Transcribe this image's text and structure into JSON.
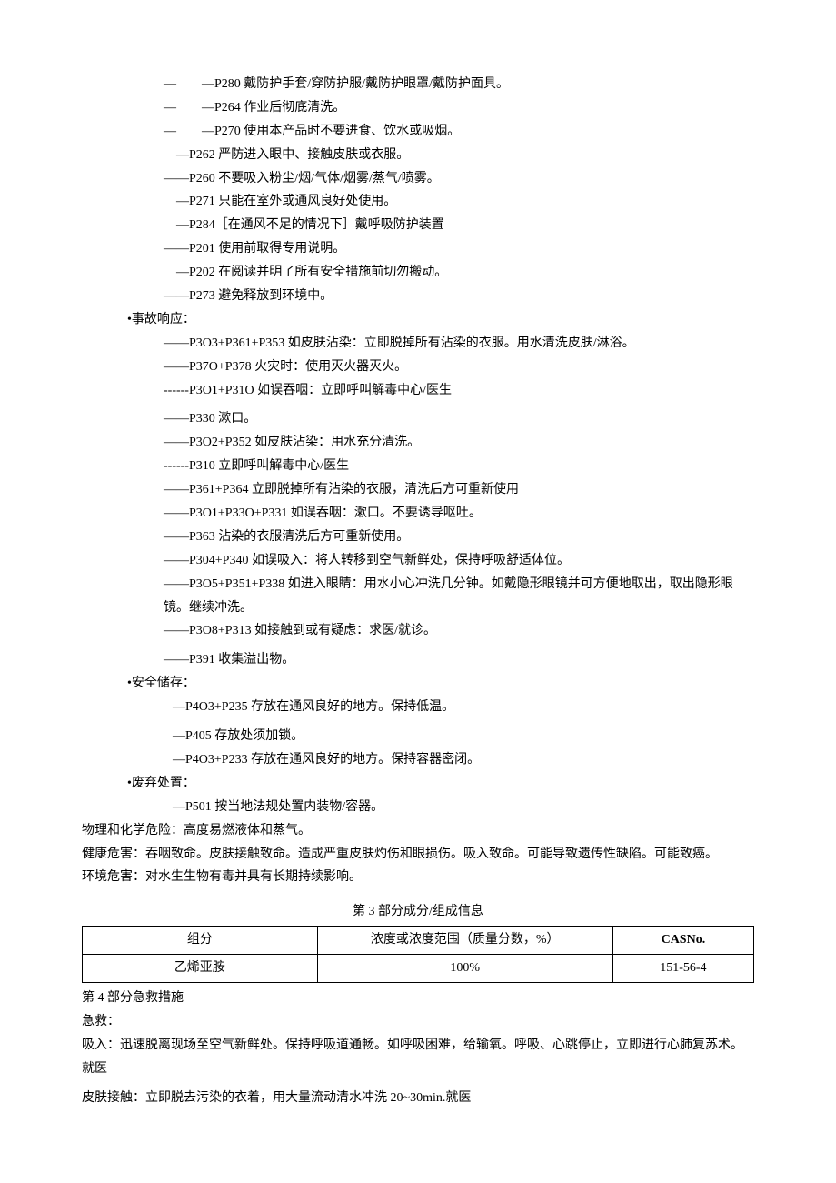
{
  "prevention": [
    "—　　—P280 戴防护手套/穿防护服/戴防护眼罩/戴防护面具。",
    "—　　—P264 作业后彻底清洗。",
    "—　　—P270 使用本产品时不要进食、饮水或吸烟。",
    "　—P262 严防进入眼中、接触皮肤或衣服。",
    "——P260 不要吸入粉尘/烟/气体/烟雾/蒸气/喷雾。",
    "　—P271 只能在室外或通风良好处使用。",
    "　—P284［在通风不足的情况下］戴呼吸防护装置",
    "——P201 使用前取得专用说明。",
    "　—P202 在阅读并明了所有安全措施前切勿搬动。",
    "——P273 避免释放到环境中。"
  ],
  "accident_label": "•事故响应：",
  "accident": [
    "——P3O3+P361+P353 如皮肤沾染：立即脱掉所有沾染的衣服。用水清洗皮肤/淋浴。",
    "——P37O+P378 火灾时：使用灭火器灭火。",
    "------P3O1+P31O 如误吞咽：立即呼叫解毒中心/医生",
    "——P330 漱口。",
    "——P3O2+P352 如皮肤沾染：用水充分清洗。",
    "------P310 立即呼叫解毒中心/医生",
    "——P361+P364 立即脱掉所有沾染的衣服，清洗后方可重新使用",
    "——P3O1+P33O+P331 如误吞咽：漱口。不要诱导呕吐。",
    "——P363 沾染的衣服清洗后方可重新使用。",
    "——P304+P340 如误吸入：将人转移到空气新鲜处，保持呼吸舒适体位。",
    "——P3O5+P351+P338 如进入眼睛：用水小心冲洗几分钟。如戴隐形眼镜并可方便地取出，取出隐形眼镜。继续冲洗。",
    "——P3O8+P313 如接触到或有疑虑：求医/就诊。",
    "——P391 收集溢出物。"
  ],
  "storage_label": "•安全储存：",
  "storage": [
    "—P4O3+P235 存放在通风良好的地方。保持低温。",
    "—P405 存放处须加锁。",
    "—P4O3+P233 存放在通风良好的地方。保持容器密闭。"
  ],
  "disposal_label": "•废弃处置：",
  "disposal": [
    "—P501 按当地法规处置内装物/容器。"
  ],
  "hazards": {
    "physical": "物理和化学危险：高度易燃液体和蒸气。",
    "health": "健康危害：吞咽致命。皮肤接触致命。造成严重皮肤灼伤和眼损伤。吸入致命。可能导致遗传性缺陷。可能致癌。",
    "environment": "环境危害：对水生生物有毒并具有长期持续影响。"
  },
  "section3_title": "第 3 部分成分/组成信息",
  "table": {
    "headers": {
      "component": "组分",
      "concentration": "浓度或浓度范围（质量分数，%）",
      "cas": "CASNo."
    },
    "row": {
      "component": "乙烯亚胺",
      "concentration": "100%",
      "cas": "151-56-4"
    }
  },
  "section4_title": "第 4 部分急救措施",
  "first_aid": {
    "label": "急救：",
    "inhale": "吸入：迅速脱离现场至空气新鲜处。保持呼吸道通畅。如呼吸困难，给输氧。呼吸、心跳停止，立即进行心肺复苏术。就医",
    "skin": "皮肤接触：立即脱去污染的衣着，用大量流动清水冲洗 20~30min.就医"
  }
}
